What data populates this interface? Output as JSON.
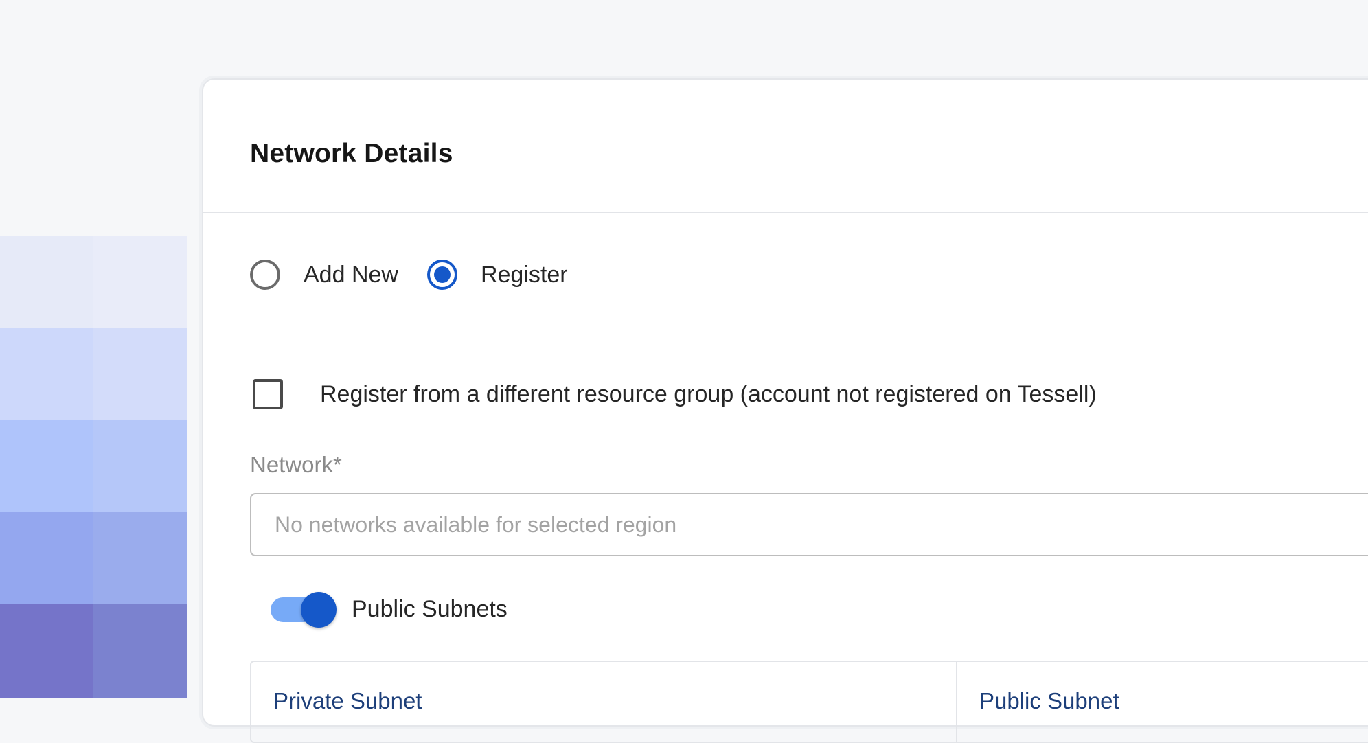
{
  "card": {
    "title": "Network Details"
  },
  "mode_options": [
    {
      "label": "Add New",
      "selected": false
    },
    {
      "label": "Register",
      "selected": true
    }
  ],
  "different_resource_group": {
    "label": "Register from a different resource group (account not registered on Tessell)",
    "checked": false
  },
  "network_field": {
    "label": "Network*",
    "placeholder": "No networks available for selected region",
    "value": ""
  },
  "public_subnets_toggle": {
    "label": "Public Subnets",
    "enabled": true
  },
  "subnet_table": {
    "columns": [
      "Private Subnet",
      "Public Subnet"
    ]
  },
  "colors": {
    "accent": "#1558c9",
    "toggle_track": "#77aaf7",
    "subnet_header_text": "#1d3f7a"
  }
}
